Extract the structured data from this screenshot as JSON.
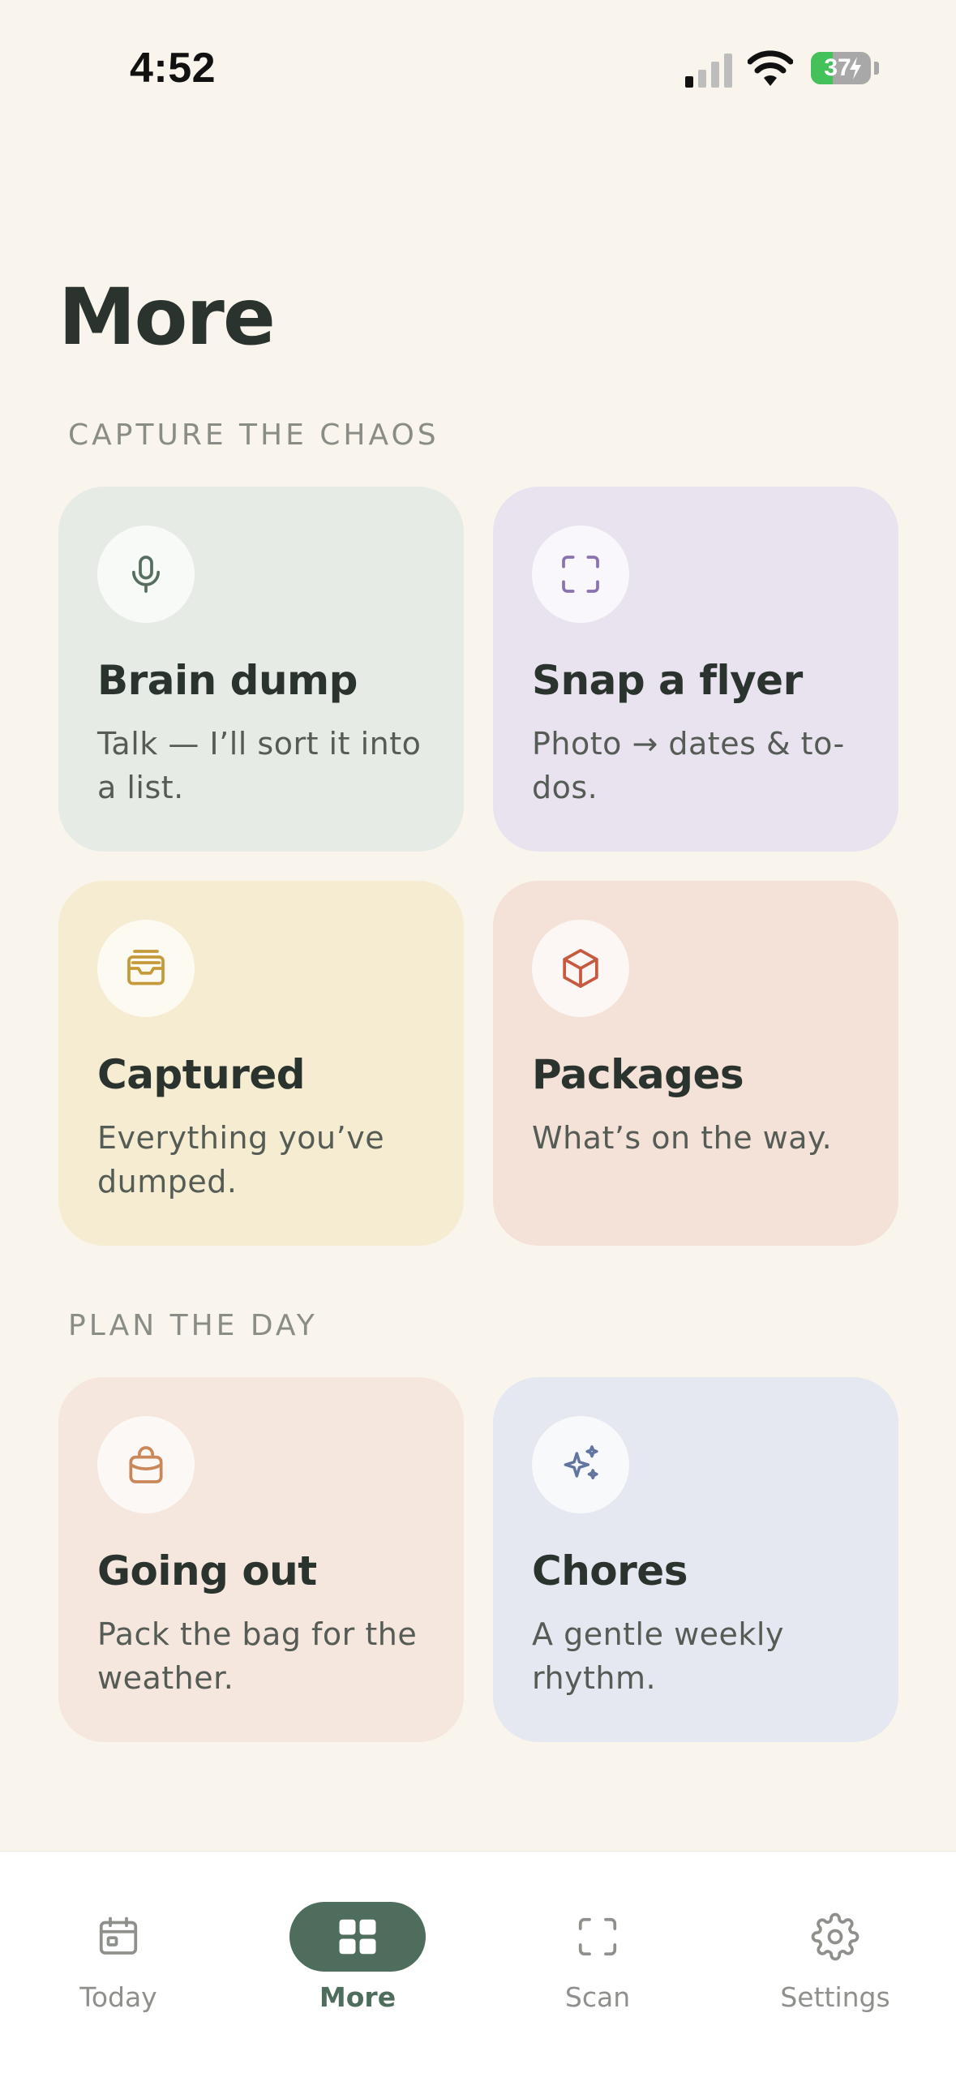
{
  "status_bar": {
    "time": "4:52",
    "battery": "37"
  },
  "page": {
    "title": "More"
  },
  "sections": [
    {
      "label": "CAPTURE THE CHAOS"
    },
    {
      "label": "PLAN THE DAY"
    }
  ],
  "cards": [
    {
      "title": "Brain dump",
      "desc": "Talk — I’ll sort it into a list.",
      "icon": "microphone-icon",
      "bg": "#e6ebe6",
      "icon_color": "#566f60"
    },
    {
      "title": "Snap a flyer",
      "desc": "Photo → dates & to-dos.",
      "icon": "scan-frame-icon",
      "bg": "#e9e3f0",
      "icon_color": "#8a72b0"
    },
    {
      "title": "Captured",
      "desc": "Everything you’ve dumped.",
      "icon": "inbox-tray-icon",
      "bg": "#f6ecd1",
      "icon_color": "#c59a3a"
    },
    {
      "title": "Packages",
      "desc": "What’s on the way.",
      "icon": "package-box-icon",
      "bg": "#f4e2d8",
      "icon_color": "#c55a3e"
    },
    {
      "title": "Going out",
      "desc": "Pack the bag for the weather.",
      "icon": "shopping-bag-icon",
      "bg": "#f5e6de",
      "icon_color": "#c9875a"
    },
    {
      "title": "Chores",
      "desc": "A gentle weekly rhythm.",
      "icon": "sparkles-icon",
      "bg": "#e5e8f0",
      "icon_color": "#6274a0"
    }
  ],
  "tabs": [
    {
      "label": "Today",
      "icon": "calendar-icon",
      "active": false
    },
    {
      "label": "More",
      "icon": "grid-icon",
      "active": true
    },
    {
      "label": "Scan",
      "icon": "scan-frame-icon",
      "active": false
    },
    {
      "label": "Settings",
      "icon": "gear-icon",
      "active": false
    }
  ]
}
